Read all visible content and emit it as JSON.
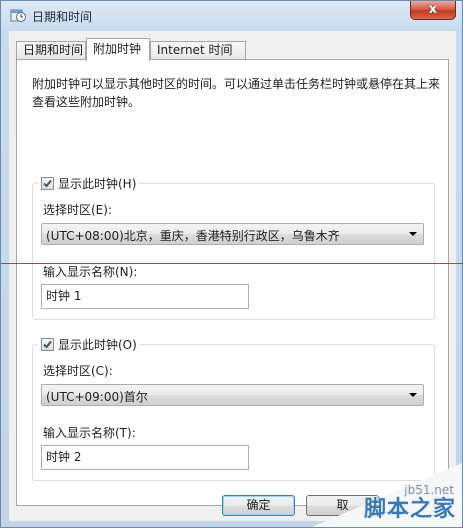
{
  "window": {
    "title": "日期和时间",
    "close_symbol": "x"
  },
  "tabs": [
    {
      "label": "日期和时间",
      "active": false
    },
    {
      "label": "附加时钟",
      "active": true
    },
    {
      "label": "Internet 时间",
      "active": false
    }
  ],
  "description": "附加时钟可以显示其他时区的时间。可以通过单击任务栏时钟或悬停在其上来查看这些附加时钟。",
  "clock1": {
    "checkbox_label": "显示此时钟(H)",
    "checked": true,
    "timezone_label": "选择时区(E):",
    "timezone_value": "(UTC+08:00)北京，重庆，香港特别行政区，乌鲁木齐",
    "name_label": "输入显示名称(N):",
    "name_value": "时钟 1"
  },
  "clock2": {
    "checkbox_label": "显示此时钟(O)",
    "checked": true,
    "timezone_label": "选择时区(C):",
    "timezone_value": "(UTC+09:00)首尔",
    "name_label": "输入显示名称(T):",
    "name_value": "时钟 2"
  },
  "buttons": {
    "ok": "确定",
    "cancel": "取"
  },
  "watermark": {
    "site": "jb51.net",
    "name": "脚本之家"
  },
  "colors": {
    "accent_line": "#c23a3a",
    "close_button": "#c43a20"
  }
}
